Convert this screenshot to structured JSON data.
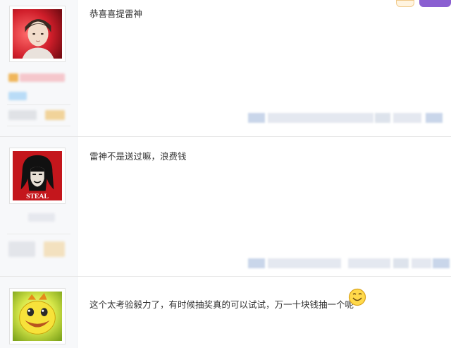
{
  "posts": [
    {
      "content": "恭喜喜提雷神"
    },
    {
      "content": "雷神不是送过嘛，浪费钱",
      "avatar_caption": "STEAL"
    },
    {
      "content": "这个太考验毅力了，有时候抽奖真的可以试试，万一十块钱抽一个呢"
    }
  ],
  "colors": {
    "user_column_bg": "#f7f8fa",
    "divider": "#e6e6e6",
    "blur_orange": "#f3c98a",
    "blur_pink": "#f5c7cc",
    "blur_blue": "#b9dcf7",
    "blur_gray": "#e3e5ea",
    "steal_bg": "#c4161c"
  },
  "icons": [
    "avatar-boy-portrait",
    "avatar-steal-poster",
    "avatar-smiley-face",
    "smiley-emoji-icon"
  ]
}
